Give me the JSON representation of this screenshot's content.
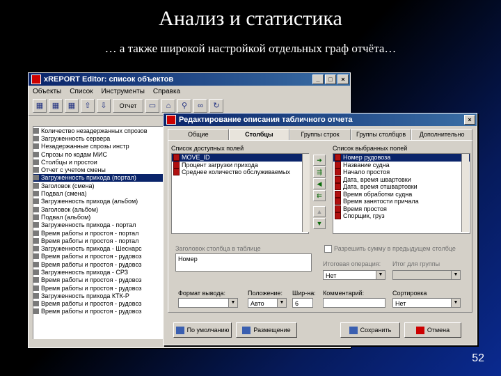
{
  "slide": {
    "title": "Анализ и статистика",
    "subtitle": "… а также широкой настройкой отдельных граф отчёта…",
    "page_number": "52"
  },
  "editor": {
    "title": "xREPORT Editor: список объектов",
    "menu": [
      "Объекты",
      "Список",
      "Инструменты",
      "Справка"
    ],
    "toolbar_report_label": "Отчет",
    "tree": [
      {
        "label": "Количество незадержанных спрозов",
        "selected": false
      },
      {
        "label": "Загруженность сервера",
        "selected": false
      },
      {
        "label": "Незадержанные спрозы инстр",
        "selected": false
      },
      {
        "label": "Спрозы по кодам МИС",
        "selected": false
      },
      {
        "label": "Столбцы и простои",
        "selected": false
      },
      {
        "label": "Отчет с учетом смены",
        "selected": false
      },
      {
        "label": "Загруженность прихода (портал)",
        "selected": true
      },
      {
        "label": "Заголовок (смена)",
        "selected": false
      },
      {
        "label": "Подвал (смена)",
        "selected": false
      },
      {
        "label": "Загруженность прихода (альбом)",
        "selected": false
      },
      {
        "label": "Заголовок (альбом)",
        "selected": false
      },
      {
        "label": "Подвал (альбом)",
        "selected": false
      },
      {
        "label": "Загруженность прихода - портал",
        "selected": false
      },
      {
        "label": "Время работы и простоя - портал",
        "selected": false
      },
      {
        "label": "Время работы и простоя - портал",
        "selected": false
      },
      {
        "label": "Загруженность прихода - Шеснарс",
        "selected": false
      },
      {
        "label": "Время работы и простоя - рудовоз",
        "selected": false
      },
      {
        "label": "Время работы и простоя - рудовоз",
        "selected": false
      },
      {
        "label": "Загруженность прихода - СРЗ",
        "selected": false
      },
      {
        "label": "Время работы и простоя - рудовоз",
        "selected": false
      },
      {
        "label": "Время работы и простоя - рудовоз",
        "selected": false
      },
      {
        "label": "Загруженность прихода КТК-Р",
        "selected": false
      },
      {
        "label": "Время работы и простоя - рудовоз",
        "selected": false
      },
      {
        "label": "Время работы и простоя - рудовоз",
        "selected": false
      }
    ]
  },
  "dialog": {
    "title": "Редактирование описания табличного отчета",
    "tabs": [
      "Общие",
      "Столбцы",
      "Группы строк",
      "Группы столбцов",
      "Дополнительно"
    ],
    "active_tab": "Столбцы",
    "available_label": "Список доступных полей",
    "available": [
      {
        "label": "MOVE_ID",
        "selected": true
      },
      {
        "label": "Процент загрузки прихода",
        "selected": false
      },
      {
        "label": "Среднее количество обслуживаемых",
        "selected": false
      }
    ],
    "selected_label": "Список выбранных полей",
    "selected": [
      {
        "label": "Номер рудовоза",
        "selected": true
      },
      {
        "label": "Название судна",
        "selected": false
      },
      {
        "label": "Начало простоя",
        "selected": false
      },
      {
        "label": "Дата, время швартовки",
        "selected": false
      },
      {
        "label": "Дата, время отшвартовки",
        "selected": false
      },
      {
        "label": "Время обработки судна",
        "selected": false
      },
      {
        "label": "Время занятости причала",
        "selected": false
      },
      {
        "label": "Время простоя",
        "selected": false
      },
      {
        "label": "Спорщик, груз",
        "selected": false
      }
    ],
    "header_label": "Заголовок столбца в таблице",
    "header_value": "Номер",
    "checkbox_label": "Разрешить сумму в предыдущем столбце",
    "total_op_label": "Итоговая операция:",
    "total_op_value": "Нет",
    "group_total_label": "Итог для группы",
    "format_label": "Формат вывода:",
    "position_label": "Положение:",
    "position_value": "Авто",
    "width_label": "Шир-на:",
    "width_value": "6",
    "comment_label": "Комментарий:",
    "sort_label": "Сортировка",
    "sort_value": "Нет",
    "btn_default": "По умолчанию",
    "btn_place": "Размещение",
    "btn_save": "Сохранить",
    "btn_cancel": "Отмена"
  },
  "colors": {
    "selection": "#0a246a",
    "titlebar": "#0a246a",
    "window": "#d4d0c8"
  }
}
